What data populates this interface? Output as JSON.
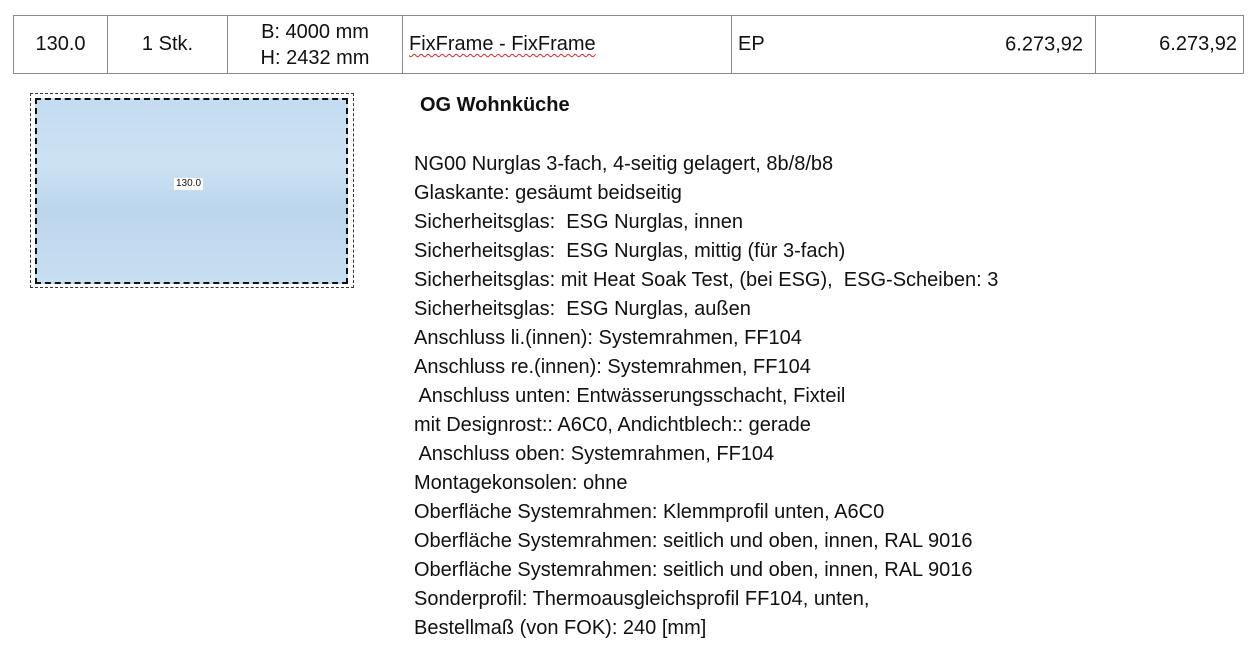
{
  "row": {
    "position": "130.0",
    "quantity": "1 Stk.",
    "width": "B: 4000 mm",
    "height": "H: 2432 mm",
    "description": "FixFrame - FixFrame",
    "price_type": "EP",
    "unit_price": "6.273,92",
    "total_price": "6.273,92"
  },
  "preview": {
    "label": "130.0",
    "glass_color": "#c6dcf0"
  },
  "room_title": "OG Wohnküche",
  "specs": [
    "NG00 Nurglas 3-fach, 4-seitig gelagert, 8b/8/b8",
    "Glaskante: gesäumt beidseitig",
    "Sicherheitsglas:  ESG Nurglas, innen",
    "Sicherheitsglas:  ESG Nurglas, mittig (für 3-fach)",
    "Sicherheitsglas: mit Heat Soak Test, (bei ESG),  ESG-Scheiben: 3",
    "Sicherheitsglas:  ESG Nurglas, außen",
    "Anschluss li.(innen): Systemrahmen, FF104",
    "Anschluss re.(innen): Systemrahmen, FF104",
    " Anschluss unten: Entwässerungsschacht, Fixteil",
    "mit Designrost:: A6C0, Andichtblech:: gerade",
    " Anschluss oben: Systemrahmen, FF104",
    "Montagekonsolen: ohne",
    "Oberfläche Systemrahmen: Klemmprofil unten, A6C0",
    "Oberfläche Systemrahmen: seitlich und oben, innen, RAL 9016",
    "Oberfläche Systemrahmen: seitlich und oben, innen, RAL 9016",
    "Sonderprofil: Thermoausgleichsprofil FF104, unten,   ",
    "Bestellmaß (von FOK): 240 [mm]"
  ]
}
